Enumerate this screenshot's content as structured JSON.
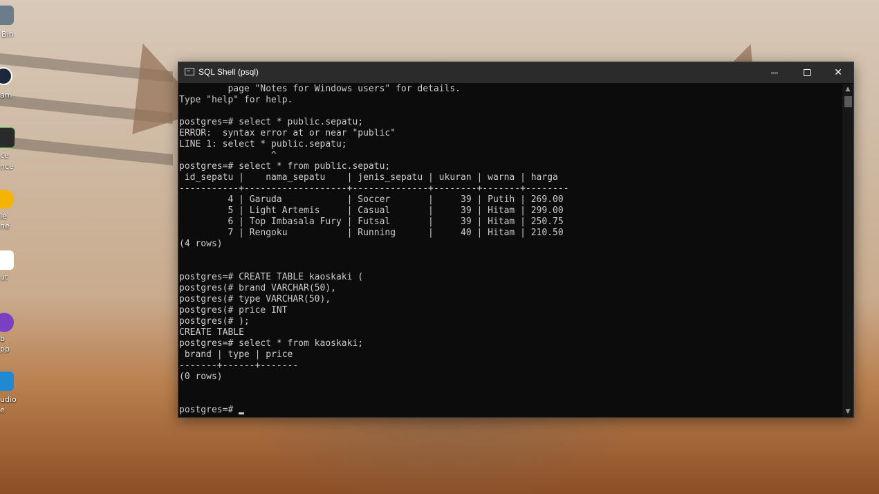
{
  "desktop": {
    "icons": [
      {
        "label": "Bin",
        "icon": "recycle-bin-icon"
      },
      {
        "label": "am",
        "icon": "steam-icon"
      },
      {
        "label": "ce",
        "icon": "sublime-icon"
      },
      {
        "label": "nce",
        "icon": "sublime-icon-line2"
      },
      {
        "label": "le",
        "icon": "chrome-icon"
      },
      {
        "label": "ne",
        "icon": "chrome-icon-line2"
      },
      {
        "label": "ut",
        "icon": "shortcut-icon"
      },
      {
        "label": "b",
        "icon": "github-desktop-icon"
      },
      {
        "label": "pp",
        "icon": "github-desktop-icon-line2"
      },
      {
        "label": "udio",
        "icon": "vscode-icon"
      },
      {
        "label": "e",
        "icon": "vscode-icon-line2"
      }
    ]
  },
  "window": {
    "title": "SQL Shell (psql)",
    "minimize_label": "",
    "maximize_label": "",
    "close_label": "✕"
  },
  "console": {
    "lines": [
      "         page \"Notes for Windows users\" for details.",
      "Type \"help\" for help.",
      "",
      "postgres=# select * public.sepatu;",
      "ERROR:  syntax error at or near \"public\"",
      "LINE 1: select * public.sepatu;",
      "                 ^",
      "postgres=# select * from public.sepatu;",
      " id_sepatu |    nama_sepatu    | jenis_sepatu | ukuran | warna | harga",
      "-----------+-------------------+--------------+--------+-------+--------",
      "         4 | Garuda            | Soccer       |     39 | Putih | 269.00",
      "         5 | Light Artemis     | Casual       |     39 | Hitam | 299.00",
      "         6 | Top Imbasala Fury | Futsal       |     39 | Hitam | 250.75",
      "         7 | Rengoku           | Running      |     40 | Hitam | 210.50",
      "(4 rows)",
      "",
      "",
      "postgres=# CREATE TABLE kaoskaki (",
      "postgres(# brand VARCHAR(50),",
      "postgres(# type VARCHAR(50),",
      "postgres(# price INT",
      "postgres(# );",
      "CREATE TABLE",
      "postgres=# select * from kaoskaki;",
      " brand | type | price",
      "-------+------+-------",
      "(0 rows)",
      "",
      "",
      "postgres=# "
    ]
  },
  "scrollbar": {
    "up_arrow": "▲",
    "down_arrow": "▼"
  }
}
